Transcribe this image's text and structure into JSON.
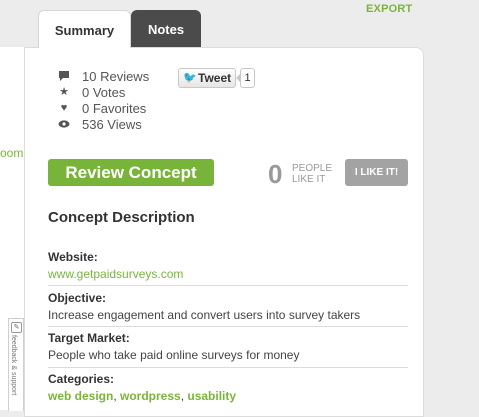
{
  "header": {
    "export_label": "EXPORT"
  },
  "tabs": [
    {
      "label": "Summary",
      "active": true
    },
    {
      "label": "Notes",
      "active": false
    }
  ],
  "left_panel": {
    "link_text": "oom",
    "feedback_text": "feedback & support"
  },
  "stats": [
    {
      "icon": "comment-icon",
      "text": "10 Reviews"
    },
    {
      "icon": "star-icon",
      "text": "0 Votes"
    },
    {
      "icon": "heart-icon",
      "text": "0 Favorites"
    },
    {
      "icon": "eye-icon",
      "text": "536 Views"
    }
  ],
  "tweet": {
    "label": "Tweet",
    "count": "1"
  },
  "review": {
    "button_label": "Review Concept"
  },
  "likes": {
    "count": "0",
    "label_line1": "PEOPLE",
    "label_line2": "LIKE IT",
    "button_label": "I LIKE IT!"
  },
  "concept": {
    "title": "Concept Description",
    "website_label": "Website:",
    "website_value": "www.getpaidsurveys.com",
    "objective_label": "Objective:",
    "objective_value": "Increase engagement and convert users into survey takers",
    "target_label": "Target Market:",
    "target_value": "People who take paid online surveys for money",
    "categories_label": "Categories:",
    "categories": [
      "web design",
      "wordpress",
      "usability"
    ]
  },
  "colors": {
    "accent": "#79b43a",
    "notes_tab": "#4b4b4b",
    "like_button": "#a3a3a3"
  }
}
